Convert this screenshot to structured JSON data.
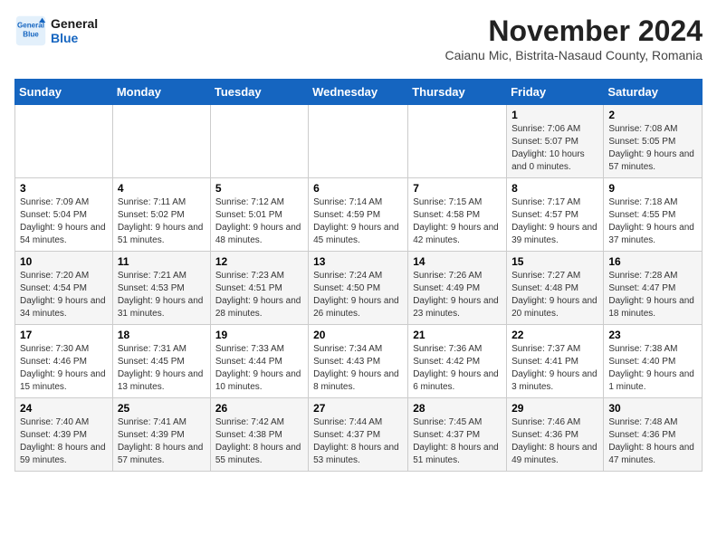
{
  "logo": {
    "line1": "General",
    "line2": "Blue"
  },
  "header": {
    "title": "November 2024",
    "subtitle": "Caianu Mic, Bistrita-Nasaud County, Romania"
  },
  "days_of_week": [
    "Sunday",
    "Monday",
    "Tuesday",
    "Wednesday",
    "Thursday",
    "Friday",
    "Saturday"
  ],
  "weeks": [
    [
      {
        "day": "",
        "info": ""
      },
      {
        "day": "",
        "info": ""
      },
      {
        "day": "",
        "info": ""
      },
      {
        "day": "",
        "info": ""
      },
      {
        "day": "",
        "info": ""
      },
      {
        "day": "1",
        "info": "Sunrise: 7:06 AM\nSunset: 5:07 PM\nDaylight: 10 hours and 0 minutes."
      },
      {
        "day": "2",
        "info": "Sunrise: 7:08 AM\nSunset: 5:05 PM\nDaylight: 9 hours and 57 minutes."
      }
    ],
    [
      {
        "day": "3",
        "info": "Sunrise: 7:09 AM\nSunset: 5:04 PM\nDaylight: 9 hours and 54 minutes."
      },
      {
        "day": "4",
        "info": "Sunrise: 7:11 AM\nSunset: 5:02 PM\nDaylight: 9 hours and 51 minutes."
      },
      {
        "day": "5",
        "info": "Sunrise: 7:12 AM\nSunset: 5:01 PM\nDaylight: 9 hours and 48 minutes."
      },
      {
        "day": "6",
        "info": "Sunrise: 7:14 AM\nSunset: 4:59 PM\nDaylight: 9 hours and 45 minutes."
      },
      {
        "day": "7",
        "info": "Sunrise: 7:15 AM\nSunset: 4:58 PM\nDaylight: 9 hours and 42 minutes."
      },
      {
        "day": "8",
        "info": "Sunrise: 7:17 AM\nSunset: 4:57 PM\nDaylight: 9 hours and 39 minutes."
      },
      {
        "day": "9",
        "info": "Sunrise: 7:18 AM\nSunset: 4:55 PM\nDaylight: 9 hours and 37 minutes."
      }
    ],
    [
      {
        "day": "10",
        "info": "Sunrise: 7:20 AM\nSunset: 4:54 PM\nDaylight: 9 hours and 34 minutes."
      },
      {
        "day": "11",
        "info": "Sunrise: 7:21 AM\nSunset: 4:53 PM\nDaylight: 9 hours and 31 minutes."
      },
      {
        "day": "12",
        "info": "Sunrise: 7:23 AM\nSunset: 4:51 PM\nDaylight: 9 hours and 28 minutes."
      },
      {
        "day": "13",
        "info": "Sunrise: 7:24 AM\nSunset: 4:50 PM\nDaylight: 9 hours and 26 minutes."
      },
      {
        "day": "14",
        "info": "Sunrise: 7:26 AM\nSunset: 4:49 PM\nDaylight: 9 hours and 23 minutes."
      },
      {
        "day": "15",
        "info": "Sunrise: 7:27 AM\nSunset: 4:48 PM\nDaylight: 9 hours and 20 minutes."
      },
      {
        "day": "16",
        "info": "Sunrise: 7:28 AM\nSunset: 4:47 PM\nDaylight: 9 hours and 18 minutes."
      }
    ],
    [
      {
        "day": "17",
        "info": "Sunrise: 7:30 AM\nSunset: 4:46 PM\nDaylight: 9 hours and 15 minutes."
      },
      {
        "day": "18",
        "info": "Sunrise: 7:31 AM\nSunset: 4:45 PM\nDaylight: 9 hours and 13 minutes."
      },
      {
        "day": "19",
        "info": "Sunrise: 7:33 AM\nSunset: 4:44 PM\nDaylight: 9 hours and 10 minutes."
      },
      {
        "day": "20",
        "info": "Sunrise: 7:34 AM\nSunset: 4:43 PM\nDaylight: 9 hours and 8 minutes."
      },
      {
        "day": "21",
        "info": "Sunrise: 7:36 AM\nSunset: 4:42 PM\nDaylight: 9 hours and 6 minutes."
      },
      {
        "day": "22",
        "info": "Sunrise: 7:37 AM\nSunset: 4:41 PM\nDaylight: 9 hours and 3 minutes."
      },
      {
        "day": "23",
        "info": "Sunrise: 7:38 AM\nSunset: 4:40 PM\nDaylight: 9 hours and 1 minute."
      }
    ],
    [
      {
        "day": "24",
        "info": "Sunrise: 7:40 AM\nSunset: 4:39 PM\nDaylight: 8 hours and 59 minutes."
      },
      {
        "day": "25",
        "info": "Sunrise: 7:41 AM\nSunset: 4:39 PM\nDaylight: 8 hours and 57 minutes."
      },
      {
        "day": "26",
        "info": "Sunrise: 7:42 AM\nSunset: 4:38 PM\nDaylight: 8 hours and 55 minutes."
      },
      {
        "day": "27",
        "info": "Sunrise: 7:44 AM\nSunset: 4:37 PM\nDaylight: 8 hours and 53 minutes."
      },
      {
        "day": "28",
        "info": "Sunrise: 7:45 AM\nSunset: 4:37 PM\nDaylight: 8 hours and 51 minutes."
      },
      {
        "day": "29",
        "info": "Sunrise: 7:46 AM\nSunset: 4:36 PM\nDaylight: 8 hours and 49 minutes."
      },
      {
        "day": "30",
        "info": "Sunrise: 7:48 AM\nSunset: 4:36 PM\nDaylight: 8 hours and 47 minutes."
      }
    ]
  ]
}
